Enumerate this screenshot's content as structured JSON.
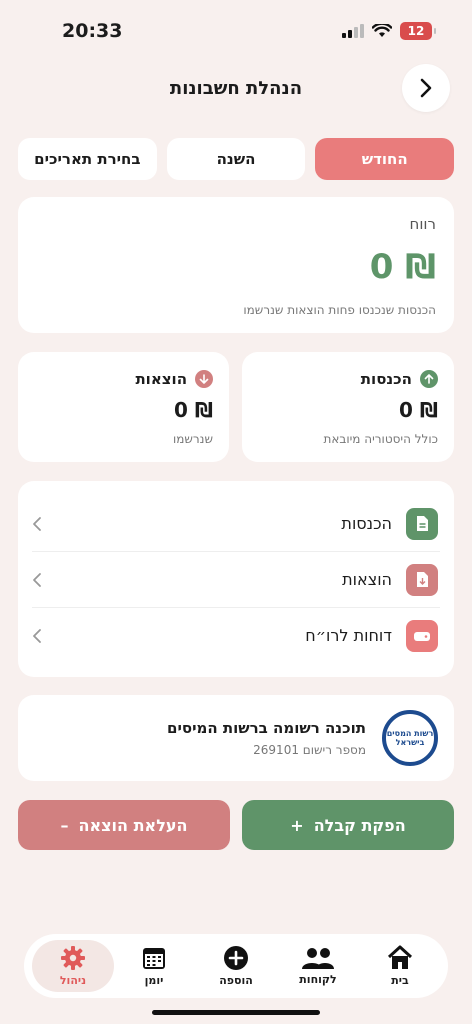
{
  "status": {
    "time": "20:33",
    "battery": "12"
  },
  "header": {
    "title": "הנהלת חשבונות"
  },
  "tabs": [
    {
      "label": "החודש",
      "active": true
    },
    {
      "label": "השנה",
      "active": false
    },
    {
      "label": "בחירת תאריכים",
      "active": false
    }
  ],
  "profit": {
    "label": "רווח",
    "value": "0 ₪",
    "description": "הכנסות שנכנסו פחות הוצאות שנרשמו"
  },
  "income": {
    "title": "הכנסות",
    "value": "0 ₪",
    "subtitle": "כולל היסטוריה מיובאת"
  },
  "expenses": {
    "title": "הוצאות",
    "value": "0 ₪",
    "subtitle": "שנרשמו"
  },
  "menu": {
    "items": [
      {
        "label": "הכנסות",
        "icon": "document-icon",
        "color": "#5f9469"
      },
      {
        "label": "הוצאות",
        "icon": "document-download-icon",
        "color": "#d18080"
      },
      {
        "label": "דוחות לרו״ח",
        "icon": "drive-icon",
        "color": "#e97c7c"
      }
    ]
  },
  "tax": {
    "logo_text": "רשות המסים בישראל",
    "title": "תוכנה רשומה ברשות המיסים",
    "registration": "מספר רישום 269101"
  },
  "actions": {
    "receipt": "הפקת קבלה",
    "expense": "העלאת הוצאה"
  },
  "tabbar": {
    "items": [
      {
        "label": "בית",
        "icon": "home-icon"
      },
      {
        "label": "לקוחות",
        "icon": "clients-icon"
      },
      {
        "label": "הוספה",
        "icon": "add-icon"
      },
      {
        "label": "יומן",
        "icon": "calendar-icon"
      },
      {
        "label": "ניהול",
        "icon": "gear-icon",
        "active": true
      }
    ]
  },
  "colors": {
    "accent": "#e97c7c",
    "green": "#5f9469",
    "red": "#d18080",
    "background": "#f8f0ee"
  }
}
